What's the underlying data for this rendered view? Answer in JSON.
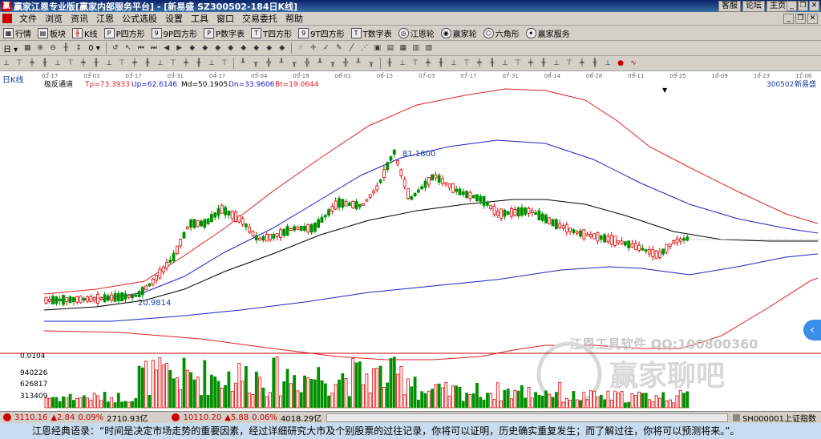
{
  "window": {
    "title": "赢家江恩专业版[赢家内部服务平台] - [新易盛  SZ300502-184日K线]",
    "links": [
      "客服",
      "论坛",
      "主页"
    ],
    "icon": "app-logo-icon"
  },
  "menu": [
    "文件",
    "浏览",
    "资讯",
    "江恩",
    "公式选股",
    "设置",
    "工具",
    "窗口",
    "交易委托",
    "帮助"
  ],
  "toolbar1": [
    {
      "label": "行情",
      "icon": "grid-icon"
    },
    {
      "label": "板块",
      "icon": "blocks-icon"
    },
    {
      "label": "K线",
      "icon": "kline-icon"
    },
    {
      "label": "P四方形",
      "icon": "square-p-icon"
    },
    {
      "label": "9P四方形",
      "icon": "square-9p-icon"
    },
    {
      "label": "P数字表",
      "icon": "table-p-icon"
    },
    {
      "label": "T四方形",
      "icon": "square-t-icon"
    },
    {
      "label": "9T四方形",
      "icon": "square-9t-icon"
    },
    {
      "label": "T数字表",
      "icon": "table-t-icon"
    },
    {
      "label": "江恩轮",
      "icon": "wheel-icon"
    },
    {
      "label": "赢家轮",
      "icon": "wheel2-icon"
    },
    {
      "label": "六角形",
      "icon": "hexagon-icon"
    },
    {
      "label": "赢家服务",
      "icon": "service-icon"
    }
  ],
  "chart_header": {
    "period": "日K线",
    "indicator": "极反通道",
    "tp": "Tp=73.3933",
    "up": "Up=62.6146",
    "md": "Md=50.1905",
    "dn": "Dn=33.9606",
    "bt": "Bt=19.0644",
    "code": "300502",
    "name": "新易盛"
  },
  "chart_data": {
    "type": "candlestick",
    "x_dates": [
      "02-17",
      "03-03",
      "03-17",
      "03-31",
      "04-17",
      "05-04",
      "05-18",
      "06-01",
      "06-15",
      "07-03",
      "07-17",
      "07-31",
      "08-14",
      "08-28",
      "09-11",
      "09-25",
      "10-09",
      "10-23",
      "11-06"
    ],
    "annotations": {
      "high": "81.1800",
      "low": "20.9814"
    },
    "volume_ticks": [
      "0.0104",
      "940226",
      "626817",
      "313409"
    ],
    "colors": {
      "up": "#e00000",
      "down": "#009000",
      "upper_band": "#e02020",
      "mid_band": "#2020c0",
      "center": "#000000"
    }
  },
  "status": {
    "sh_index": "3110.16",
    "sh_change": "2.84",
    "sh_pct": "0.09%",
    "sh_amount": "2710.93亿",
    "sz_index": "10110.20",
    "sz_change": "5.88",
    "sz_pct": "0.06%",
    "sz_amount": "4018.29亿",
    "ticker": "SH000001上证指数"
  },
  "watermark": {
    "line1": "江恩工具软件 QQ:100800360",
    "line2": "赢家聊吧"
  },
  "quote": "江恩经典语录：“时间是决定市场走势的重要因素，经过详细研究大市及个别股票的过往记录，你将可以证明，历史确实重复发生；而了解过往，你将可以预测将来。”。"
}
